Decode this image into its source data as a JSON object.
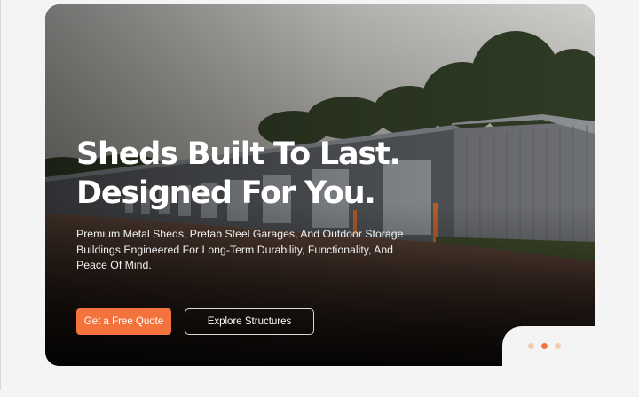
{
  "hero": {
    "headline_line1": "Sheds Built To Last.",
    "headline_line2": "Designed For You.",
    "description": "Premium Metal Sheds, Prefab Steel Garages, And Outdoor Storage Buildings Engineered For Long-Term Durability, Functionality, And Peace Of Mind.",
    "primary_cta": "Get a Free Quote",
    "secondary_cta": "Explore Structures",
    "background_image": "photo of metal storage unit buildings with roll-up doors, trees behind, dirt lot in foreground"
  },
  "carousel": {
    "slide_count": 3,
    "active_index": 1
  },
  "colors": {
    "accent": "#f4733c",
    "dot_inactive": "#f6c7b1",
    "page_background": "#f4f4f4"
  }
}
